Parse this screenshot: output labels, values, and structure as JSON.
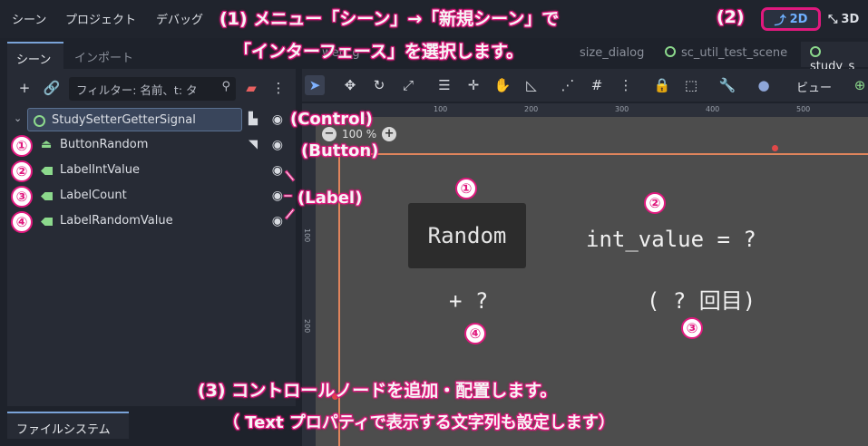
{
  "menu": {
    "items": [
      "シーン",
      "プロジェクト",
      "デバッグ"
    ]
  },
  "modes": {
    "two_d": "2D",
    "three_d": "3D"
  },
  "dock": {
    "tabs": {
      "scene": "シーン",
      "import": "インポート"
    },
    "filter_placeholder": "フィルター: 名前、t: タ",
    "bottom_tab": "ファイルシステム"
  },
  "tree": {
    "root": "StudySetterGetterSignal",
    "nodes": [
      "ButtonRandom",
      "LabelIntValue",
      "LabelCount",
      "LabelRandomValue"
    ]
  },
  "scene_tabs": [
    "web_g",
    "size_dialog",
    "sc_util_test_scene",
    "study_s"
  ],
  "editor": {
    "view_menu": "ビュー",
    "zoom": "100 %",
    "ruler_h": [
      "100",
      "200",
      "300",
      "400",
      "500"
    ],
    "ruler_v": [
      "100",
      "200"
    ]
  },
  "canvas": {
    "button_text": "Random",
    "int_value": "int_value = ?",
    "count": "( ? 回目)",
    "random_value": "+ ?"
  },
  "annotations": {
    "step1_line1": "(1) メニュー「シーン」→「新規シーン」で",
    "step1_line2": "「インターフェース」を選択します。",
    "step2": "(2)",
    "control": "(Control)",
    "button": "(Button)",
    "label": "(Label)",
    "step3_line1": "(3) コントロールノードを追加・配置します。",
    "step3_line2": "（ Text プロパティで表示する文字列も設定します）",
    "numbers": [
      "①",
      "②",
      "③",
      "④"
    ]
  },
  "colors": {
    "accent": "#e0197e",
    "node_green": "#8cd98c",
    "guide": "#e0845c"
  }
}
